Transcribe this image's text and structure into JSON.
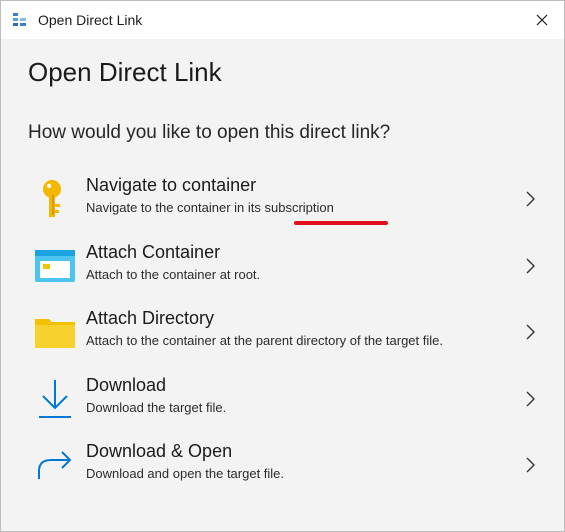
{
  "window": {
    "title": "Open Direct Link",
    "icon": "storage-explorer-icon",
    "close_icon": "close-icon"
  },
  "page": {
    "heading": "Open Direct Link",
    "question": "How would you like to open this direct link?"
  },
  "options": [
    {
      "title": "Navigate to container",
      "description": "Navigate to the container in its subscription",
      "icon": "key-icon"
    },
    {
      "title": "Attach Container",
      "description": "Attach to the container at root.",
      "icon": "container-window-icon"
    },
    {
      "title": "Attach Directory",
      "description": "Attach to the container at the parent directory of the target file.",
      "icon": "folder-icon"
    },
    {
      "title": "Download",
      "description": "Download the target file.",
      "icon": "download-arrow-icon"
    },
    {
      "title": "Download & Open",
      "description": "Download and open the target file.",
      "icon": "forward-arrow-icon"
    }
  ],
  "annotation": {
    "color": "#e0101e"
  },
  "colors": {
    "accent": "#0078d4",
    "key": "#f5b800",
    "folder": "#f2c200"
  }
}
